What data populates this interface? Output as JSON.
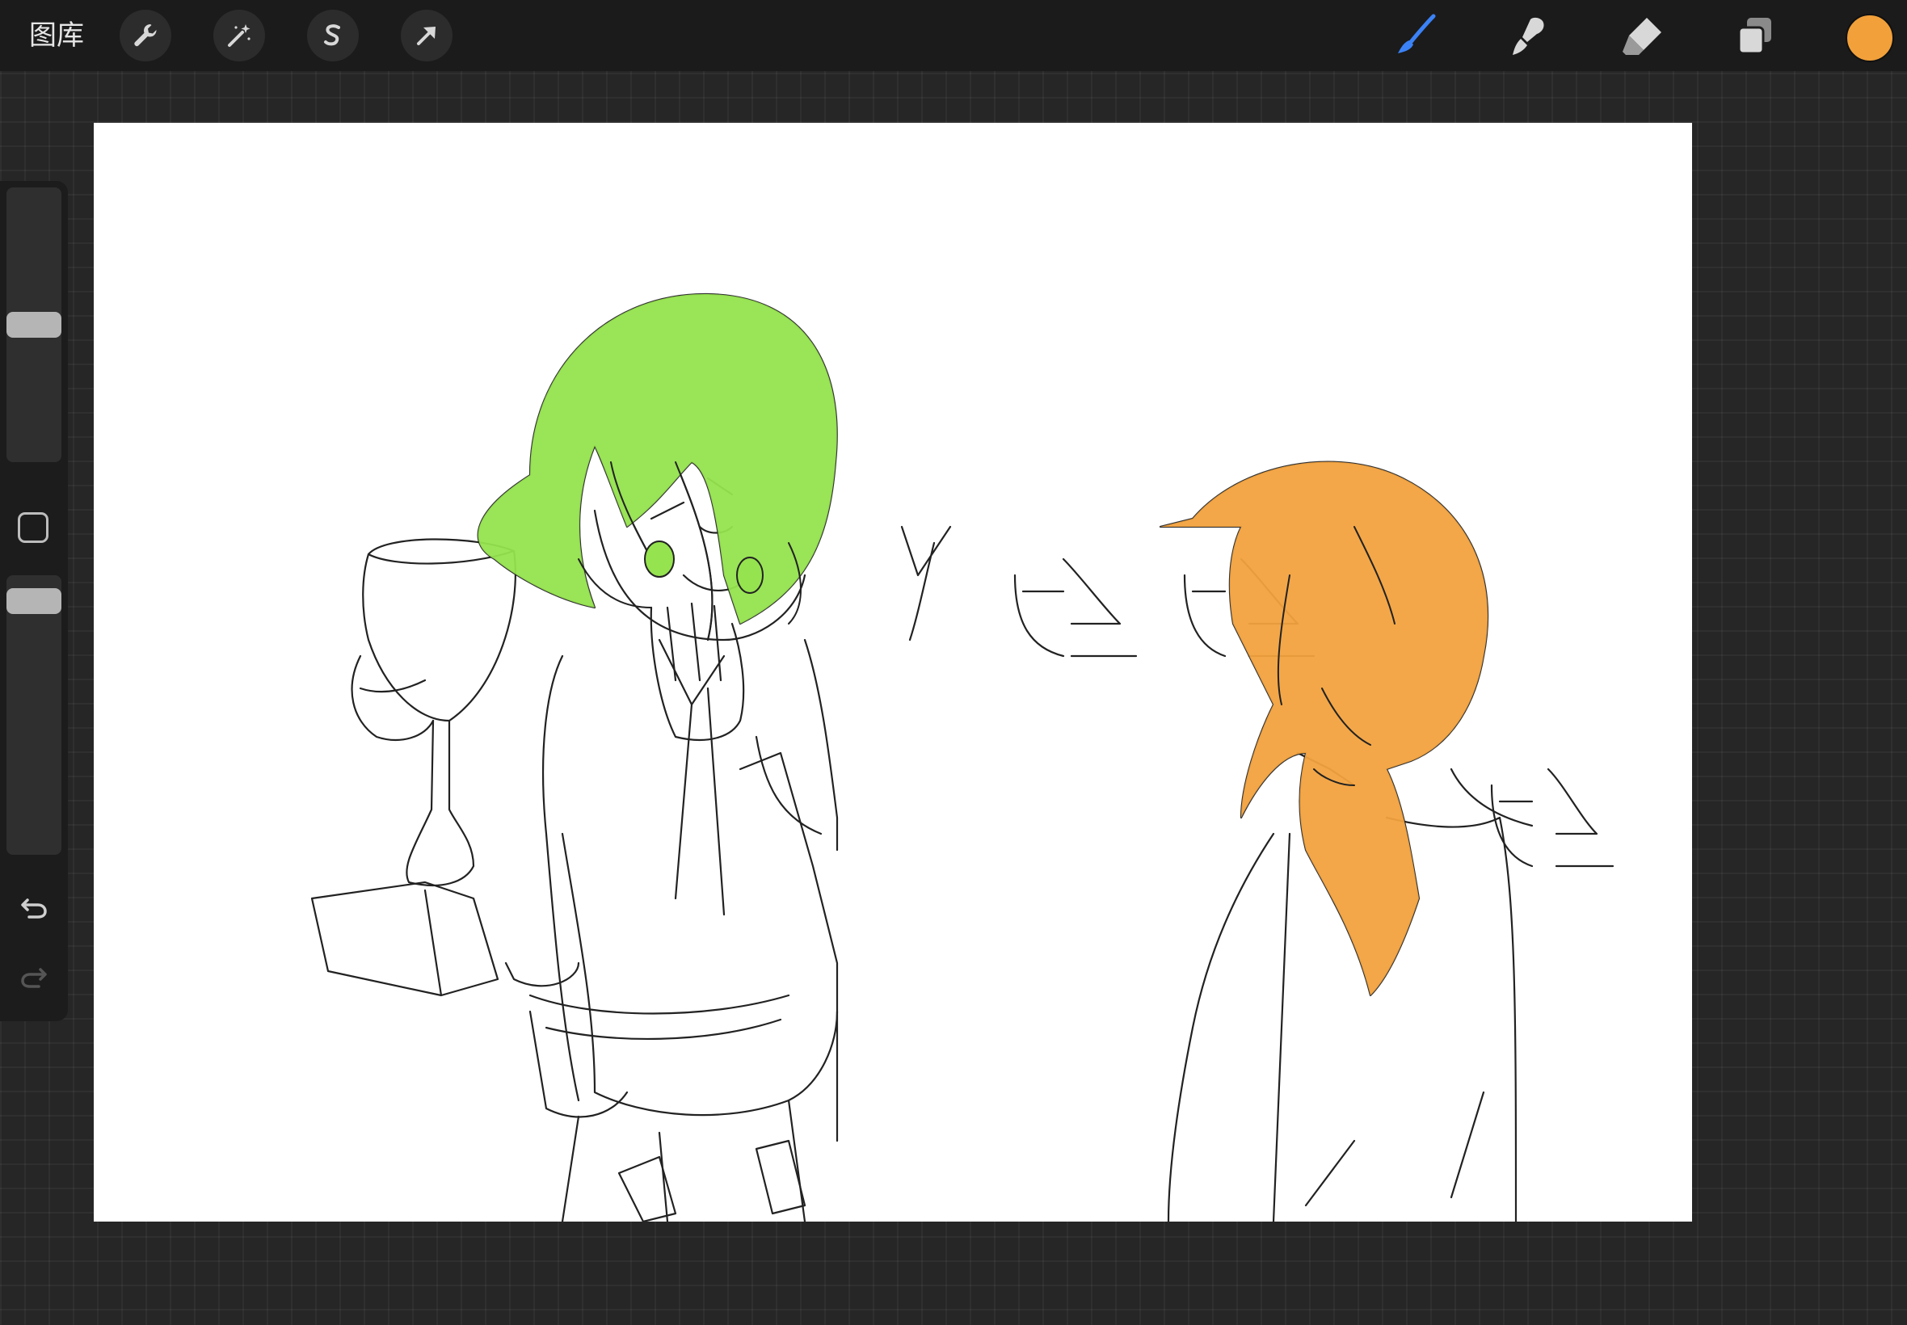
{
  "topbar": {
    "gallery_label": "图库",
    "left_tools": [
      "wrench-icon",
      "magic-wand-icon",
      "selection-s-icon",
      "move-arrow-icon"
    ],
    "right_tools": [
      "brush-icon",
      "smudge-icon",
      "eraser-icon",
      "layers-icon"
    ],
    "active_tool": "brush-icon",
    "current_color": "#F2A03A"
  },
  "sidebar": {
    "brush_size_level": 0.5,
    "opacity_level": 0.95,
    "buttons": [
      "modify-square-icon",
      "undo-icon",
      "redo-icon"
    ]
  },
  "canvas": {
    "background": "#FFFFFF",
    "hair_green": "#95E34E",
    "hair_orange": "#F2A23E",
    "handwritten_text": [
      "哈",
      "哈",
      "哈"
    ]
  }
}
